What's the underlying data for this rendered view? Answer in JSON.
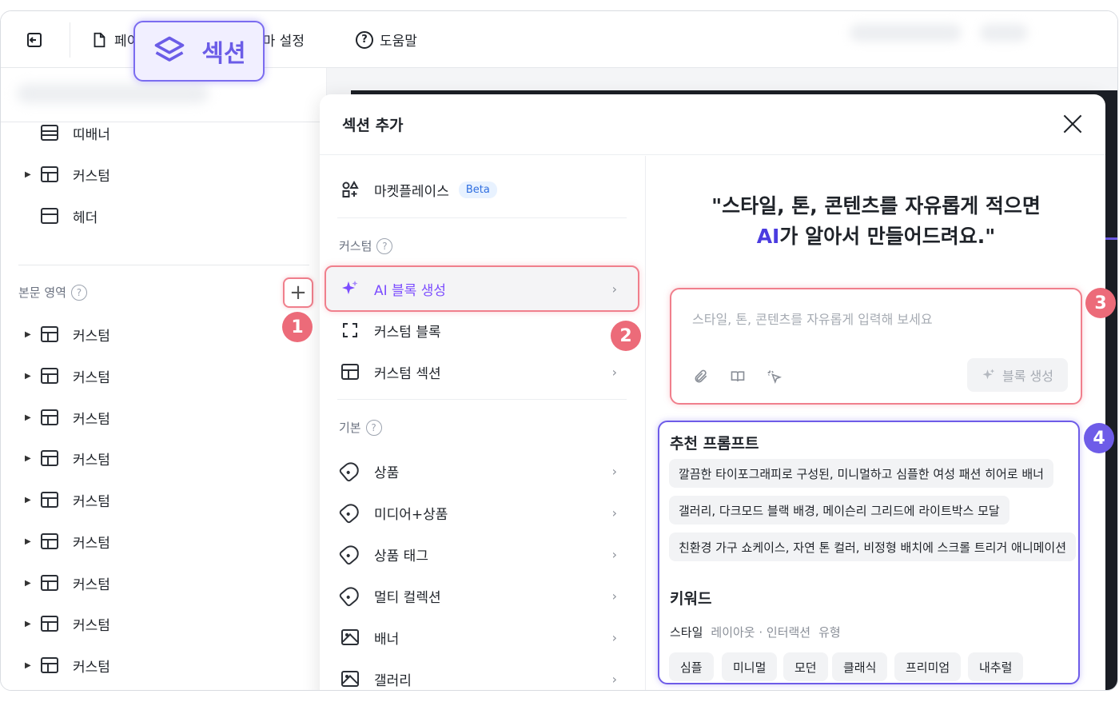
{
  "topbar": {
    "exit_icon": "exit-icon",
    "page_label": "페이",
    "theme_label": "테마 설정",
    "help_label": "도움말"
  },
  "section_chip": {
    "label": "섹션",
    "icon": "layers-icon"
  },
  "left_panel": {
    "tree_top": [
      {
        "label": "띠배너",
        "icon": "banner-icon",
        "expandable": false
      },
      {
        "label": "커스텀",
        "icon": "layout-icon",
        "expandable": true
      },
      {
        "label": "헤더",
        "icon": "header-icon",
        "expandable": false
      }
    ],
    "body_area_label": "본문 영역",
    "body_items": [
      "커스텀",
      "커스텀",
      "커스텀",
      "커스텀",
      "커스텀",
      "커스텀",
      "커스텀",
      "커스텀",
      "커스텀"
    ]
  },
  "badges": {
    "b1": "1",
    "b2": "2",
    "b3": "3",
    "b4": "4"
  },
  "modal": {
    "title": "섹션 추가",
    "marketplace": {
      "label": "마켓플레이스",
      "badge": "Beta"
    },
    "custom_group": "커스텀",
    "ai_block": "AI 블록 생성",
    "custom_block": "커스텀 블록",
    "custom_section": "커스텀 섹션",
    "basic_group": "기본",
    "basic_items": [
      "상품",
      "미디어+상품",
      "상품 태그",
      "멀티 컬렉션",
      "배너",
      "갤러리"
    ],
    "headline_line1": "\"스타일, 톤, 콘텐츠를 자유롭게 적으면",
    "headline_ai": "AI",
    "headline_line2": "가 알아서 만들어드려요.\"",
    "prompt_placeholder": "스타일, 톤, 콘텐츠를 자유롭게 입력해 보세요",
    "generate_button": "블록 생성",
    "reco_title": "추천 프롬프트",
    "reco_prompts": [
      "깔끔한 타이포그래피로 구성된, 미니멀하고 심플한 여성 패션 히어로 배너",
      "갤러리, 다크모드 블랙 배경, 메이슨리 그리드에 라이트박스 모달",
      "친환경 가구 쇼케이스, 자연 톤 컬러, 비정형 배치에 스크롤 트리거 애니메이션"
    ],
    "keyword_title": "키워드",
    "keyword_filters": [
      "스타일",
      "레이아웃 · 인터랙션",
      "유형"
    ],
    "keywords": [
      "심플",
      "미니멀",
      "모던",
      "클래식",
      "프리미엄",
      "내추럴"
    ]
  },
  "colors": {
    "accent_purple": "#6e5ce8",
    "highlight_red": "#f07f8c",
    "ai_text": "#7c4dff"
  }
}
